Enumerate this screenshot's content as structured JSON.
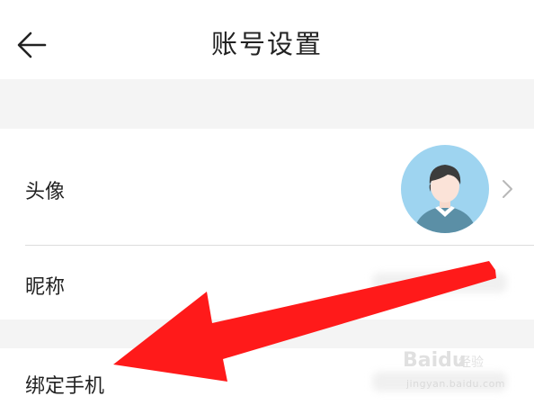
{
  "header": {
    "title": "账号设置",
    "back_icon": "arrow-left-icon"
  },
  "rows": [
    {
      "label": "头像",
      "trailing": "avatar-image",
      "chevron": "chevron-right-icon"
    },
    {
      "label": "昵称"
    },
    {
      "label": "绑定手机"
    }
  ],
  "overlay": {
    "arrow_color": "#ff1a1a"
  },
  "watermark": {
    "logo": "Baidu",
    "sub": "经验",
    "url": "jingyan.baidu.com"
  }
}
